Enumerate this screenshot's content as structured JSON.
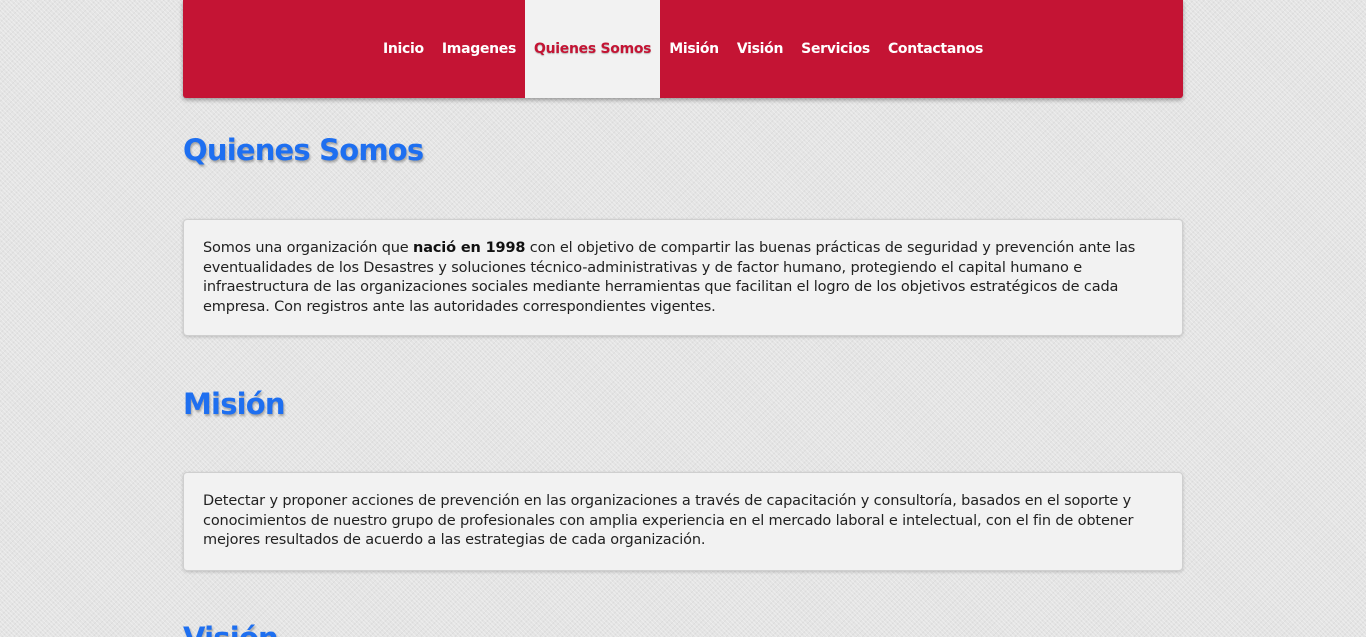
{
  "nav": {
    "items": [
      {
        "label": "Inicio",
        "active": false
      },
      {
        "label": "Imagenes",
        "active": false
      },
      {
        "label": "Quienes Somos",
        "active": true
      },
      {
        "label": "Misión",
        "active": false
      },
      {
        "label": "Visión",
        "active": false
      },
      {
        "label": "Servicios",
        "active": false
      },
      {
        "label": "Contactanos",
        "active": false
      }
    ]
  },
  "sections": {
    "quienes": {
      "title": "Quienes Somos",
      "text_before": "Somos una organización que ",
      "text_bold": "nació en 1998",
      "text_after": " con el objetivo de compartir las buenas prácticas de seguridad y prevención ante las eventualidades de los Desastres y soluciones técnico-administrativas y de factor humano, protegiendo el capital humano e infraestructura de las organizaciones sociales mediante herramientas que facilitan el logro de los objetivos estratégicos de cada empresa. Con registros ante las autoridades correspondientes vigentes."
    },
    "mision": {
      "title": "Misión",
      "text": "Detectar y proponer acciones de prevención en las organizaciones a través de capacitación y consultoría, basados en el soporte y conocimientos de nuestro grupo de profesionales con amplia experiencia en el mercado laboral e intelectual, con el fin de obtener mejores resultados de acuerdo a las estrategias de cada organización."
    },
    "vision": {
      "title": "Visión"
    }
  },
  "colors": {
    "navbar": "#c41434",
    "heading": "#1e6ff0",
    "card_bg": "#f2f2f2"
  }
}
